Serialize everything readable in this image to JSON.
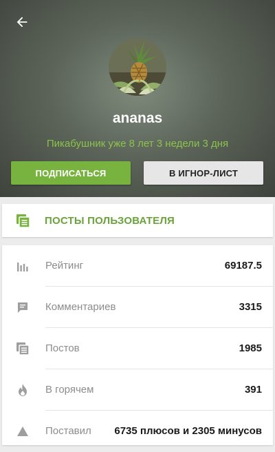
{
  "profile": {
    "username": "ananas",
    "tenure": "Пикабушник уже 8 лет 3 недели 3 дня",
    "subscribe_label": "ПОДПИСАТЬСЯ",
    "ignore_label": "В ИГНОР-ЛИСТ",
    "avatar_icon": "pineapple-avatar",
    "back_icon": "arrow-left-icon"
  },
  "posts_link": {
    "label": "ПОСТЫ ПОЛЬЗОВАТЕЛЯ",
    "icon": "posts-icon"
  },
  "stats": [
    {
      "icon": "bar-chart-icon",
      "label": "Рейтинг",
      "value": "69187.5"
    },
    {
      "icon": "comment-icon",
      "label": "Комментариев",
      "value": "3315"
    },
    {
      "icon": "posts-icon",
      "label": "Постов",
      "value": "1985"
    },
    {
      "icon": "fire-icon",
      "label": "В горячем",
      "value": "391"
    },
    {
      "icon": "triangle-icon",
      "label": "Поставил",
      "value": "6735 плюсов и 2305 минусов"
    }
  ],
  "colors": {
    "accent_green": "#78b33f",
    "tenure_green": "#8bc34a",
    "posts_green": "#6aa33a"
  }
}
